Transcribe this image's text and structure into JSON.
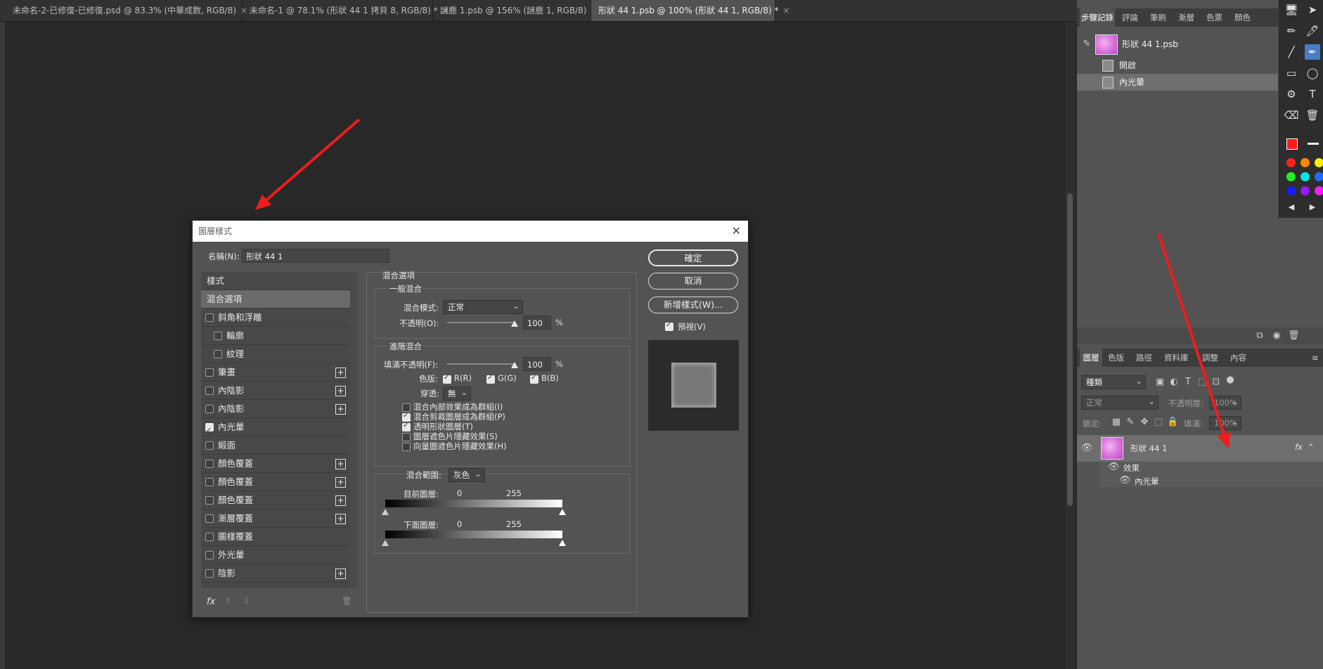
{
  "doc_tabs": [
    {
      "label": "未命名-2-已修復-已修復.psd @ 83.3% (中華成数, RGB/8)",
      "close": "×"
    },
    {
      "label": "未命名-1 @ 78.1% (形狀 44 1 拷貝 8, RGB/8) *",
      "close": "×"
    },
    {
      "label": "謎鹿 1.psb @ 156% (謎鹿 1, RGB/8)",
      "close": "×"
    },
    {
      "label": "形狀 44 1.psb @ 100% (形狀 44 1, RGB/8) *",
      "close": "×"
    }
  ],
  "history_panel": {
    "tabs": [
      "步驟記錄",
      "評論",
      "筆刷",
      "漸層",
      "色票",
      "顏色"
    ],
    "snapshot": "形狀 44 1.psb",
    "items": [
      "開啟",
      "內光暈"
    ]
  },
  "layers_panel": {
    "tabs": [
      "圖層",
      "色版",
      "路徑",
      "資料庫",
      "調整",
      "內容"
    ],
    "filter_placeholder": "種類",
    "blend_mode": "正常",
    "opacity_label": "不透明度:",
    "opacity_value": "100%",
    "lock_label": "鎖定:",
    "fill_label": "填滿:",
    "fill_value": "100%",
    "layer_name": "形狀 44 1",
    "fx": "fx",
    "effects_label": "效果",
    "effect_item": "內光暈"
  },
  "dialog": {
    "title": "圖層樣式",
    "name_label": "名稱(N):",
    "name_value": "形狀 44 1",
    "buttons": {
      "ok": "確定",
      "cancel": "取消",
      "new_style": "新增樣式(W)..."
    },
    "preview_label": "預視(V)",
    "styles_header": "樣式",
    "style_items": [
      {
        "label": "混合選項",
        "check": false,
        "plus": false,
        "selected": true,
        "indent": false,
        "nocb": true
      },
      {
        "label": "斜角和浮雕",
        "check": false,
        "plus": false
      },
      {
        "label": "輪廓",
        "check": false,
        "plus": false,
        "indent": true
      },
      {
        "label": "紋理",
        "check": false,
        "plus": false,
        "indent": true
      },
      {
        "label": "筆畫",
        "check": false,
        "plus": true
      },
      {
        "label": "內陰影",
        "check": false,
        "plus": true
      },
      {
        "label": "內陰影",
        "check": false,
        "plus": true
      },
      {
        "label": "內光暈",
        "check": true,
        "plus": false
      },
      {
        "label": "緞面",
        "check": false,
        "plus": false
      },
      {
        "label": "顏色覆蓋",
        "check": false,
        "plus": true
      },
      {
        "label": "顏色覆蓋",
        "check": false,
        "plus": true
      },
      {
        "label": "顏色覆蓋",
        "check": false,
        "plus": true
      },
      {
        "label": "漸層覆蓋",
        "check": false,
        "plus": true
      },
      {
        "label": "圖樣覆蓋",
        "check": false,
        "plus": false
      },
      {
        "label": "外光暈",
        "check": false,
        "plus": false
      },
      {
        "label": "陰影",
        "check": false,
        "plus": true
      }
    ],
    "footer_fx": "fx",
    "blend_options": {
      "section_title": "混合選項",
      "general_title": "一般混合",
      "blend_mode_label": "混合模式:",
      "blend_mode_value": "正常",
      "opacity_label": "不透明(O):",
      "opacity_value": "100",
      "percent": "%",
      "advanced_title": "進階混合",
      "fill_opacity_label": "填滿不透明(F):",
      "fill_opacity_value": "100",
      "channels_label": "色版:",
      "channels": [
        "R(R)",
        "G(G)",
        "B(B)"
      ],
      "knockout_label": "穿透:",
      "knockout_value": "無",
      "options": [
        {
          "label": "混合內部效果成為群組(I)",
          "check": false
        },
        {
          "label": "混合剪裁圖層成為群組(P)",
          "check": true
        },
        {
          "label": "透明形狀圖層(T)",
          "check": true
        },
        {
          "label": "圖層遮色片隱藏效果(S)",
          "check": false
        },
        {
          "label": "向量圖遮色片隱藏效果(H)",
          "check": false
        }
      ],
      "blend_if_label": "混合範圍:",
      "blend_if_value": "灰色",
      "this_layer_label": "目前圖層:",
      "underlying_label": "下面圖層:",
      "range_min": "0",
      "range_max": "255",
      "progress_opacity": 1.0
    }
  },
  "colors": {
    "accent_blue": "#4a7cc4",
    "arrow_red": "#ee1c1c"
  },
  "toolstrip_swatches": [
    "#ff2020",
    "#ff8a00",
    "#ffee00",
    "#22ee22",
    "#00e5e5",
    "#1e6bff",
    "#1a1aff",
    "#9a1aff",
    "#ff1aff"
  ]
}
